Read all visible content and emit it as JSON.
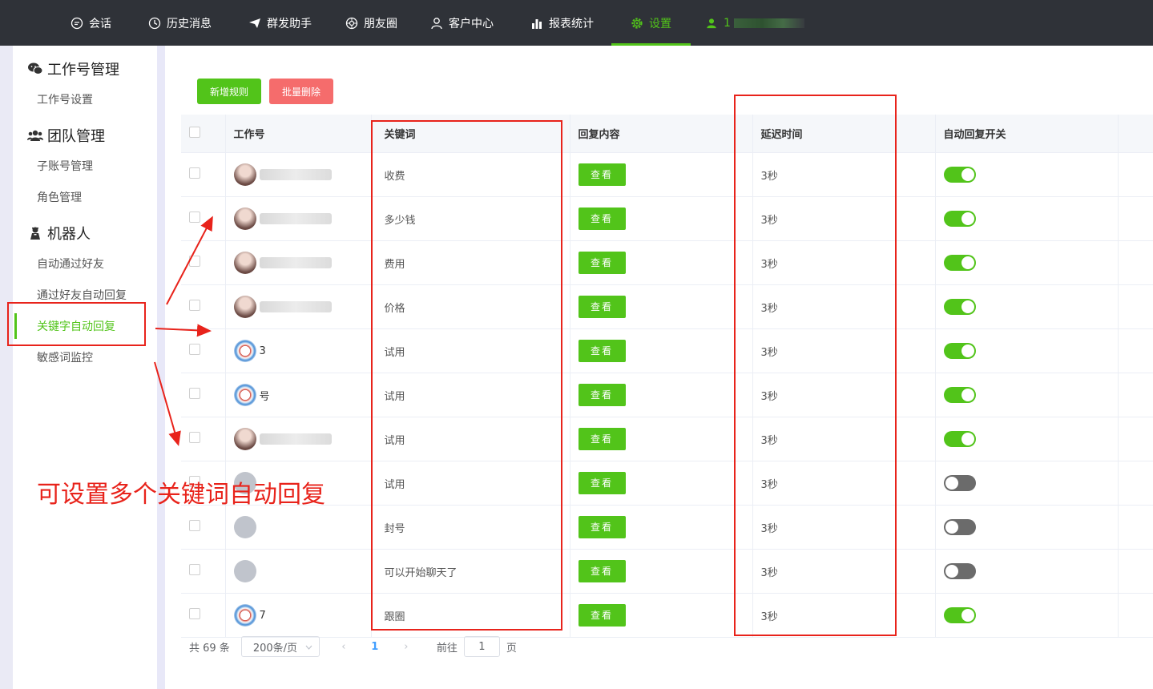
{
  "nav": {
    "items": [
      {
        "label": "会话",
        "icon": "chat-icon"
      },
      {
        "label": "历史消息",
        "icon": "clock-icon"
      },
      {
        "label": "群发助手",
        "icon": "send-icon"
      },
      {
        "label": "朋友圈",
        "icon": "aperture-icon"
      },
      {
        "label": "客户中心",
        "icon": "user-icon"
      },
      {
        "label": "报表统计",
        "icon": "bar-chart-icon"
      },
      {
        "label": "设置",
        "icon": "gear-icon",
        "active": true
      }
    ],
    "user_fragment": "1",
    "active_color": "#52c41a"
  },
  "sidebar": {
    "groups": [
      {
        "title": "工作号管理",
        "icon": "wechat-icon",
        "items": [
          "工作号设置"
        ]
      },
      {
        "title": "团队管理",
        "icon": "team-icon",
        "items": [
          "子账号管理",
          "角色管理"
        ]
      },
      {
        "title": "机器人",
        "icon": "robot-icon",
        "items": [
          "自动通过好友",
          "通过好友自动回复",
          "关键字自动回复",
          "敏感词监控"
        ]
      }
    ],
    "active_item": "关键字自动回复"
  },
  "toolbar": {
    "add_label": "新增规则",
    "delete_label": "批量删除"
  },
  "table": {
    "headers": [
      "工作号",
      "关键词",
      "回复内容",
      "延迟时间",
      "自动回复开关"
    ],
    "view_label": "查看",
    "rows": [
      {
        "avatar": "photo",
        "name": "",
        "keyword": "收费",
        "delay": "3秒",
        "enabled": true
      },
      {
        "avatar": "photo",
        "name": "",
        "keyword": "多少钱",
        "delay": "3秒",
        "enabled": true
      },
      {
        "avatar": "photo",
        "name": "",
        "keyword": "费用",
        "delay": "3秒",
        "enabled": true
      },
      {
        "avatar": "photo",
        "name": "",
        "keyword": "价格",
        "delay": "3秒",
        "enabled": true
      },
      {
        "avatar": "logo",
        "name": "3",
        "keyword": "试用",
        "delay": "3秒",
        "enabled": true
      },
      {
        "avatar": "logo",
        "name": "号",
        "keyword": "试用",
        "delay": "3秒",
        "enabled": true
      },
      {
        "avatar": "photo",
        "name": "",
        "keyword": "试用",
        "delay": "3秒",
        "enabled": true
      },
      {
        "avatar": "gray",
        "name": "",
        "keyword": "试用",
        "delay": "3秒",
        "enabled": false
      },
      {
        "avatar": "gray",
        "name": "",
        "keyword": "封号",
        "delay": "3秒",
        "enabled": false
      },
      {
        "avatar": "gray",
        "name": "",
        "keyword": "可以开始聊天了",
        "delay": "3秒",
        "enabled": false
      },
      {
        "avatar": "logo",
        "name": "7",
        "keyword": "跟圈",
        "delay": "3秒",
        "enabled": true
      }
    ]
  },
  "pager": {
    "total": "共 69 条",
    "page_size": "200条/页",
    "prev": "‹",
    "current": "1",
    "next": "›",
    "goto_label": "前往",
    "goto_value": "1",
    "page_unit": "页"
  },
  "annotation": {
    "text": "可设置多个关键词自动回复",
    "color": "#e8231b"
  }
}
